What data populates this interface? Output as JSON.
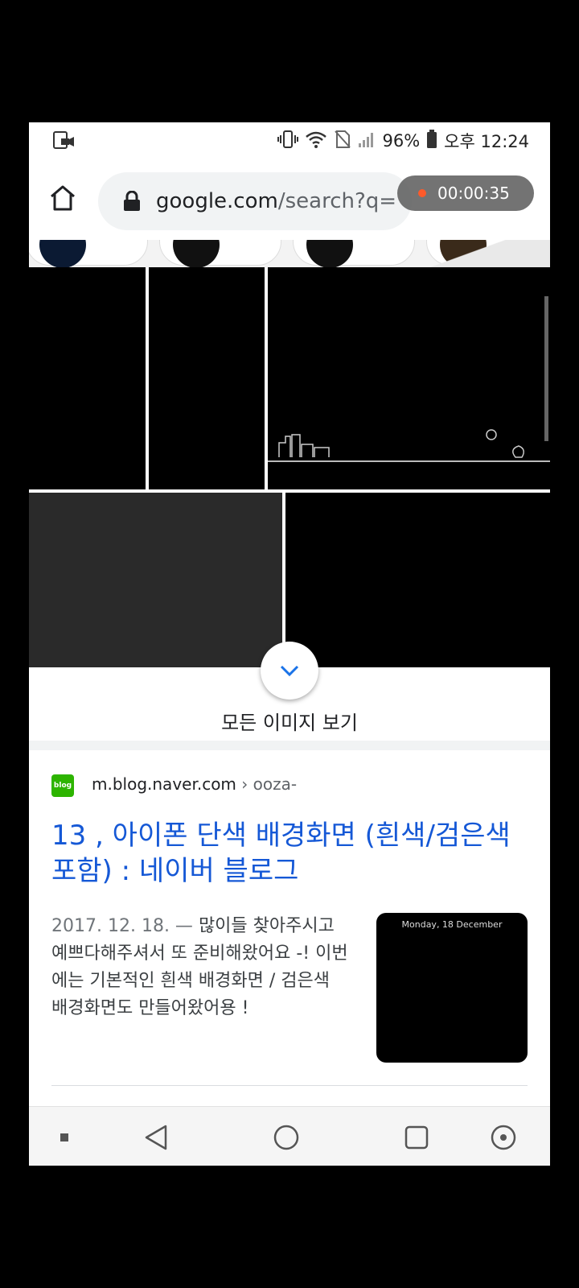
{
  "status_bar": {
    "battery": "96%",
    "time": "오후 12:24",
    "icons": [
      "screen-record-icon",
      "vibrate-icon",
      "wifi-icon",
      "no-sim-icon",
      "signal-icon",
      "battery-icon"
    ]
  },
  "browser": {
    "url_host": "google.com",
    "url_path": "/search?q=",
    "recording_timer": "00:00:35",
    "icons": [
      "home-icon",
      "lock-icon",
      "tabs-icon",
      "menu-icon"
    ]
  },
  "images": {
    "see_all_label": "모든 이미지 보기",
    "thumb_caption": "Monday, 18 December"
  },
  "result": {
    "favicon_text": "blog",
    "site": "m.blog.naver.com",
    "breadcrumb": "› ooza-",
    "title": "13 , 아이폰 단색 배경화면 (흰색/검은색 포함) : 네이버 블로그",
    "date": "2017. 12. 18. —",
    "snippet": "많이들 찾아주시고 예쁘다해주셔서 또 준비해왔어요 -! 이번에는 기본적인 흰색 배경화면 / 검은색 배경화면도 만들어왔어용 !"
  },
  "colors": {
    "link": "#1558d6",
    "naver_green": "#2db400",
    "record_dot": "#ff5a2a"
  },
  "nav_bar": [
    "square-dot-icon",
    "back-icon",
    "home-circle-icon",
    "recents-icon",
    "assistant-icon"
  ]
}
